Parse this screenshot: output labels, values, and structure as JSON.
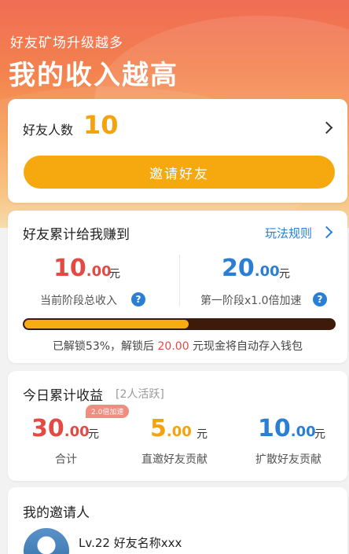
{
  "header": {
    "subtitle": "好友矿场升级越多",
    "title": "我的收入越高"
  },
  "friends_card": {
    "label": "好友人数",
    "count": "10",
    "invite_button": "邀请好友"
  },
  "earnings_card": {
    "title": "好友累计给我赚到",
    "rules_link": "玩法规则",
    "left": {
      "int": "10",
      "dec": ".00",
      "unit": "元",
      "caption": "当前阶段总收入"
    },
    "right": {
      "int": "20",
      "dec": ".00",
      "unit": "元",
      "caption": "第一阶段x1.0倍加速"
    },
    "help_icon": "?",
    "progress": {
      "percent": 53
    },
    "unlock_prefix": "已解锁53%，解锁后 ",
    "unlock_amount": "20.00",
    "unlock_suffix": " 元现金将自动存入钱包"
  },
  "today_card": {
    "title": "今日累计收益",
    "active": "[2人活跃]",
    "badge": "2.0倍加速",
    "total": {
      "int": "30",
      "dec": ".00",
      "unit": "元",
      "caption": "合计"
    },
    "direct": {
      "int": "5",
      "dec": ".00",
      "unit": "元",
      "caption": "直邀好友贡献"
    },
    "spread": {
      "int": "10",
      "dec": ".00",
      "unit": "元",
      "caption": "扩散好友贡献"
    }
  },
  "inviter_card": {
    "title": "我的邀请人",
    "name": "Lv.22 好友名称xxx"
  },
  "colors": {
    "accent_orange": "#f6a90f",
    "red": "#e24a43",
    "blue": "#2a7fd4"
  }
}
